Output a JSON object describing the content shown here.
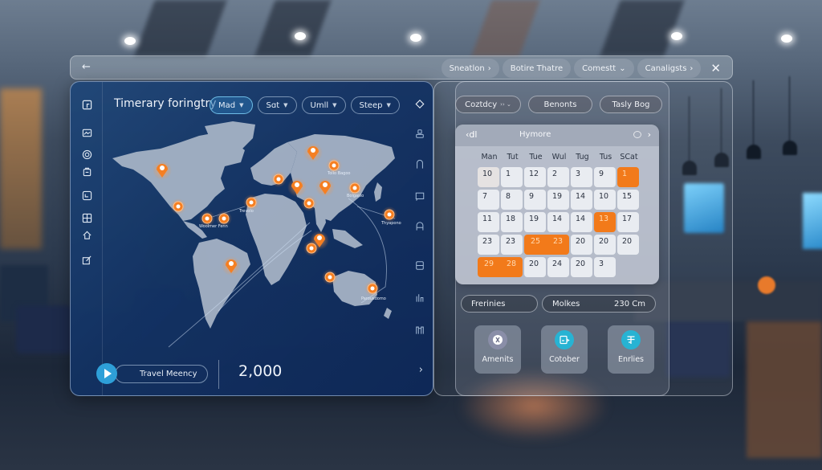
{
  "topbar": {
    "back_icon": "arrow-left-icon",
    "chips": [
      {
        "label": "Sneatlon",
        "suffix": "›"
      },
      {
        "label": "Botire Thatre",
        "suffix": ""
      },
      {
        "label": "Comestt",
        "suffix": "⌄"
      },
      {
        "label": "Canaligsts",
        "suffix": "›"
      }
    ],
    "close_icon": "close-icon"
  },
  "map_panel": {
    "title": "Timerary foringtry",
    "filters": [
      {
        "label": "Mad",
        "active": true
      },
      {
        "label": "Sɑt",
        "active": false
      },
      {
        "label": "Umll",
        "active": false
      },
      {
        "label": "Steep",
        "active": false
      }
    ],
    "left_rail_icons": [
      "panel-icon",
      "image-icon",
      "globe-icon",
      "bag-icon",
      "refresh-icon",
      "grid-icon",
      "home-icon",
      "edit-icon"
    ],
    "right_rail_icons": [
      "diamond-icon",
      "user-icon",
      "route-icon",
      "chat-icon",
      "letter-icon",
      "card-icon",
      "chart-icon",
      "columns-icon"
    ],
    "footer": {
      "travel_label": "Travel Meency",
      "count": "2,000"
    },
    "map_labels": [
      "Trevolo",
      "Woolmer Fenn",
      "Tollo Bagoo",
      "Bolgaslo",
      "Thyapono",
      "Parousdomo"
    ]
  },
  "right_panel": {
    "chips": [
      {
        "label": "Coztdcy",
        "suffix": "›› ⌄"
      },
      {
        "label": "Benonts",
        "suffix": ""
      },
      {
        "label": "Tasly Bog",
        "suffix": ""
      }
    ],
    "calendar": {
      "prev_label": "‹dl",
      "month": "Hymore",
      "weekdays": [
        "Man",
        "Tut",
        "Tue",
        "Wul",
        "Tug",
        "Tus",
        "SCat"
      ],
      "weeks": [
        [
          {
            "d": "10",
            "dim": true
          },
          {
            "d": "1"
          },
          {
            "d": "12"
          },
          {
            "d": "2"
          },
          {
            "d": "3"
          },
          {
            "d": "9"
          },
          {
            "d": "1",
            "sel": true
          }
        ],
        [
          {
            "d": "7"
          },
          {
            "d": "8"
          },
          {
            "d": "9"
          },
          {
            "d": "19"
          },
          {
            "d": "14"
          },
          {
            "d": "10"
          },
          {
            "d": "15"
          }
        ],
        [
          {
            "d": "11"
          },
          {
            "d": "18"
          },
          {
            "d": "19"
          },
          {
            "d": "14"
          },
          {
            "d": "14"
          },
          {
            "d": "13",
            "sel": true
          },
          {
            "d": "17"
          }
        ],
        [
          {
            "d": "23"
          },
          {
            "d": "23"
          },
          {
            "d": "25",
            "d2": "23",
            "sel": true,
            "span": 2
          },
          {
            "d": "20"
          },
          {
            "d": "20"
          },
          {
            "d": "20"
          }
        ],
        [
          {
            "d": "29",
            "d2": "28",
            "sel": true,
            "span": 2
          },
          {
            "d": "20"
          },
          {
            "d": "24"
          },
          {
            "d": "20"
          },
          {
            "d": "3"
          }
        ]
      ]
    },
    "info": {
      "left_label": "Frerinies",
      "right_label": "Molkes",
      "right_value": "230 Cm"
    },
    "tiles": [
      {
        "label": "Amenits",
        "icon": "badge-icon",
        "color": "#8a8ea8"
      },
      {
        "label": "Cotober",
        "icon": "calendar-icon",
        "color": "#27b3d3"
      },
      {
        "label": "Enrlies",
        "icon": "entries-icon",
        "color": "#27b3d3"
      }
    ]
  },
  "colors": {
    "accent_orange": "#f27a1a",
    "accent_blue": "#2e9fd8",
    "panel_navy": "#12336a"
  }
}
